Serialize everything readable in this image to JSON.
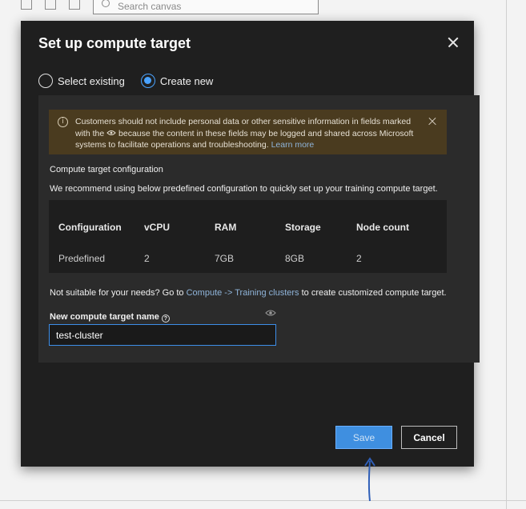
{
  "background": {
    "search_placeholder": "Search canvas"
  },
  "dialog": {
    "title": "Set up compute target",
    "radio_options": {
      "select_existing": "Select existing",
      "create_new": "Create new",
      "selected": "create_new"
    },
    "warning": {
      "text_part1": "Customers should not include personal data or other sensitive information in fields marked with the",
      "text_part2": "because the content in these fields may be logged and shared across Microsoft systems to facilitate operations and troubleshooting.",
      "link": "Learn more"
    },
    "section_title": "Compute target configuration",
    "recommend_text": "We recommend using below predefined configuration to quickly set up your training compute target.",
    "table": {
      "headers": [
        "Configuration",
        "vCPU",
        "RAM",
        "Storage",
        "Node count"
      ],
      "rows": [
        [
          "Predefined",
          "2",
          "7GB",
          "8GB",
          "2"
        ]
      ]
    },
    "not_suitable": {
      "prefix": "Not suitable for your needs? Go to",
      "link": "Compute -> Training clusters",
      "suffix": "to create customized compute target."
    },
    "name_field": {
      "label": "New compute target name",
      "value": "test-cluster"
    },
    "buttons": {
      "save": "Save",
      "cancel": "Cancel"
    }
  },
  "colors": {
    "dialog_bg": "#1f1f1f",
    "panel_bg": "#2b2b2b",
    "warning_bg": "#4a3b1f",
    "accent": "#3f8fe0",
    "link": "#8fb4d9"
  },
  "icons": {
    "info": "info-icon",
    "eye": "eye-icon",
    "help": "help-icon",
    "close": "close-icon"
  }
}
